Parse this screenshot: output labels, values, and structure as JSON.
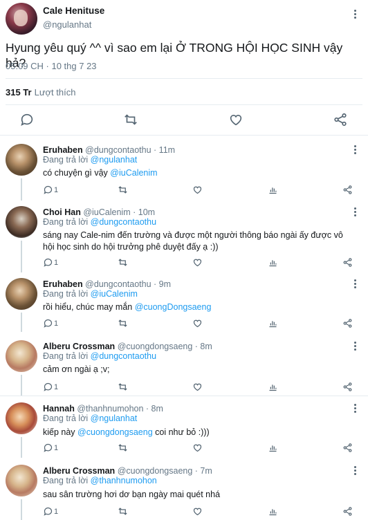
{
  "main": {
    "name": "Cale Henituse",
    "handle": "@ngulanhat",
    "text": "Hyung yêu quý ^^ vì sao em lại Ở TRONG HỘI HỌC SINH vậy hả?",
    "time": "05:09 CH · 10 thg 7 23",
    "likes_count": "315 Tr",
    "likes_label": "Lượt thích"
  },
  "replies": [
    {
      "name": "Eruhaben",
      "handle": "@dungcontaothu",
      "time": "· 11m",
      "replying_prefix": "Đang trả lời",
      "replying_to": "@ngulanhat",
      "text_before": "có chuyện gì vậy",
      "mention": "@iuCalenim",
      "text_after": "",
      "reply_count": "1"
    },
    {
      "name": "Choi Han",
      "handle": "@iuCalenim",
      "time": "· 10m",
      "replying_prefix": "Đang trả lời",
      "replying_to": "@dungcontaothu",
      "text_before": "sáng nay Cale-nim đến trường và được một người thông báo ngài ấy được vô hội học sinh do hội trưởng phê duyệt đấy ạ :))",
      "mention": "",
      "text_after": "",
      "reply_count": "1"
    },
    {
      "name": "Eruhaben",
      "handle": "@dungcontaothu",
      "time": "· 9m",
      "replying_prefix": "Đang trả lời",
      "replying_to": "@iuCalenim",
      "text_before": "rồi hiểu, chúc may mắn",
      "mention": "@cuongDongsaeng",
      "text_after": "",
      "reply_count": "1"
    },
    {
      "name": "Alberu Crossman",
      "handle": "@cuongdongsaeng",
      "time": "· 8m",
      "replying_prefix": "Đang trả lời",
      "replying_to": "@dungcontaothu",
      "text_before": "cảm ơn ngài ạ ;v;",
      "mention": "",
      "text_after": "",
      "reply_count": "1"
    },
    {
      "name": "Hannah",
      "handle": "@thanhnumohon",
      "time": "· 8m",
      "replying_prefix": "Đang trả lời",
      "replying_to": "@ngulanhat",
      "text_before": "kiếp này",
      "mention": "@cuongdongsaeng",
      "text_after": "coi như bỏ :)))",
      "reply_count": "1"
    },
    {
      "name": "Alberu Crossman",
      "handle": "@cuongdongsaeng",
      "time": "· 7m",
      "replying_prefix": "Đang trả lời",
      "replying_to": "@thanhnumohon",
      "text_before": "sau sân trường hơi dơ bạn ngày mai quét nhá",
      "mention": "",
      "text_after": "",
      "reply_count": "1"
    }
  ],
  "icons": {
    "reply": "comment-icon",
    "retweet": "retweet-icon",
    "like": "heart-icon",
    "analytics": "bar-chart-icon",
    "share": "share-icon",
    "more": "more-vertical-icon"
  },
  "colors": {
    "link": "#1d9bf0",
    "secondary": "#657786",
    "text": "#14171a",
    "divider": "#e6ecf0"
  }
}
